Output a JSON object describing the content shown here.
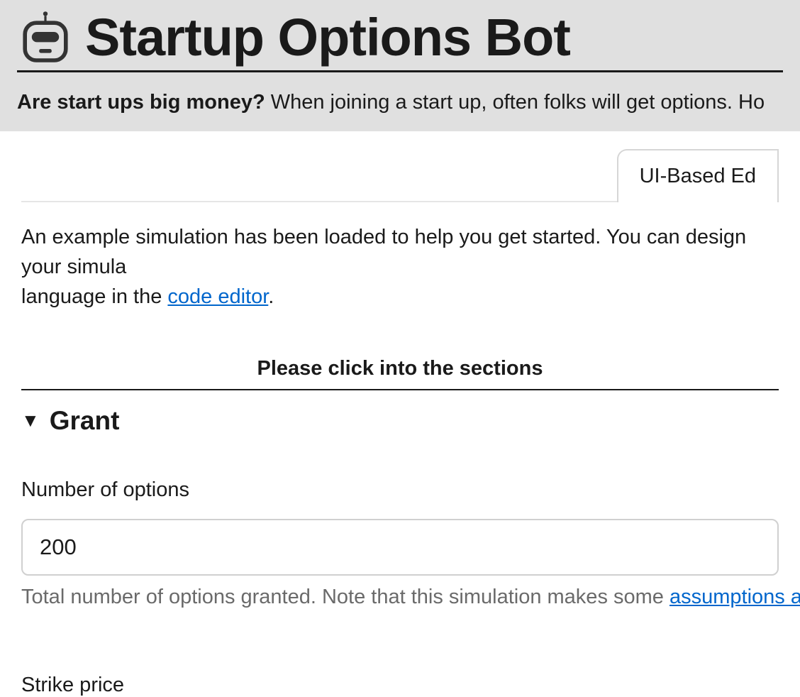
{
  "header": {
    "title": "Startup Options Bot",
    "subtitle_bold": "Are start ups big money?",
    "subtitle_rest": " When joining a start up, often folks will get options. Ho"
  },
  "tabs": {
    "active": "UI-Based Ed"
  },
  "intro": {
    "line1": "An example simulation has been loaded to help you get started. You can design your simula",
    "line2_prefix": "language in the ",
    "link_text": "code editor",
    "line2_suffix": "."
  },
  "instruction": "Please click into the sections ",
  "section": {
    "title": "Grant"
  },
  "fields": {
    "numOptions": {
      "label": "Number of options",
      "value": "200",
      "help_prefix": "Total number of options granted. Note that this simulation makes some ",
      "help_link": "assumptions a"
    },
    "strikePrice": {
      "label": "Strike price"
    }
  }
}
